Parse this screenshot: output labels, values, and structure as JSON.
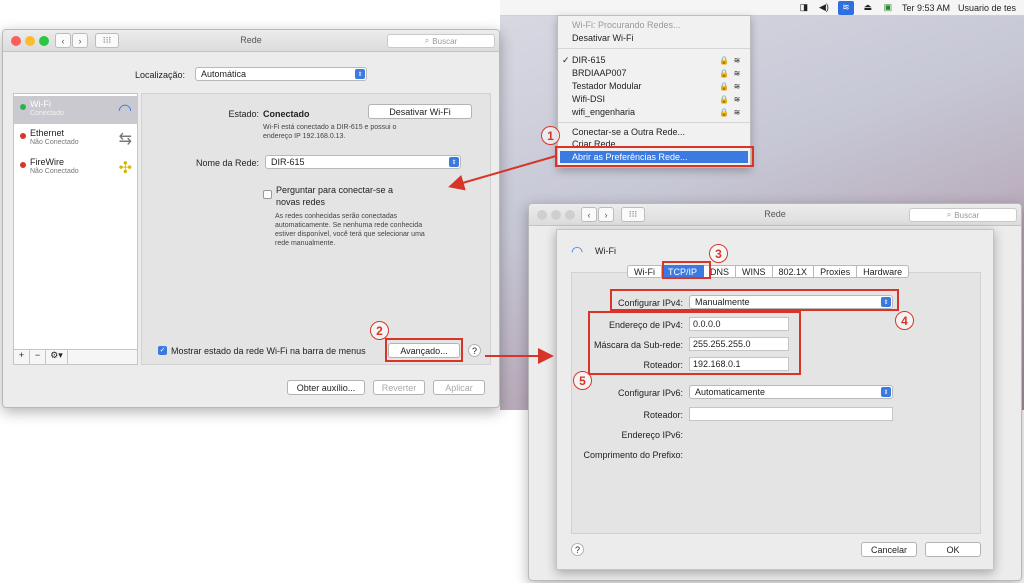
{
  "menubar": {
    "clock": "Ter 9:53 AM",
    "user": "Usuario de tes"
  },
  "wifi_menu": {
    "status": "Wi-Fi: Procurando Redes...",
    "toggle": "Desativar Wi-Fi",
    "networks": [
      {
        "name": "DIR-615",
        "checked": "✓"
      },
      {
        "name": "BRDIAAP007",
        "checked": ""
      },
      {
        "name": "Testador Modular",
        "checked": ""
      },
      {
        "name": "Wifi-DSI",
        "checked": ""
      },
      {
        "name": "wifi_engenharia",
        "checked": ""
      }
    ],
    "other": "Conectar-se a Outra Rede...",
    "create": "Criar Rede...",
    "prefs": "Abrir as Preferências Rede..."
  },
  "main_window": {
    "title": "Rede",
    "search": "Buscar",
    "location_label": "Localização:",
    "location_value": "Automática",
    "services": [
      {
        "name": "Wi-Fi",
        "status": "Conectado",
        "color": "#29b34a"
      },
      {
        "name": "Ethernet",
        "status": "Não Conectado",
        "color": "#d8352a"
      },
      {
        "name": "FireWire",
        "status": "Não Conectado",
        "color": "#d8352a"
      }
    ],
    "state_label": "Estado:",
    "state_value": "Conectado",
    "disable_wifi": "Desativar Wi-Fi",
    "state_desc_1": "Wi-Fi está conectado a DIR-615 e possui o",
    "state_desc_2": "endereço IP 192.168.0.13.",
    "network_label": "Nome da Rede:",
    "network_value": "DIR-615",
    "ask_label_1": "Perguntar para conectar-se a",
    "ask_label_2": "novas redes",
    "ask_desc_1": "As redes conhecidas serão conectadas",
    "ask_desc_2": "automaticamente. Se nenhuma rede conhecida",
    "ask_desc_3": "estiver disponível, você terá que selecionar uma",
    "ask_desc_4": "rede manualmente.",
    "show_menu": "Mostrar estado da rede Wi-Fi na barra de menus",
    "advanced": "Avançado...",
    "help": "?",
    "assist": "Obter auxílio...",
    "revert": "Reverter",
    "apply": "Aplicar",
    "plus": "+",
    "minus": "−",
    "gear": "⚙▾"
  },
  "adv_window": {
    "title": "Rede",
    "search": "Buscar",
    "wifi_label": "Wi-Fi",
    "tabs": [
      "Wi-Fi",
      "TCP/IP",
      "DNS",
      "WINS",
      "802.1X",
      "Proxies",
      "Hardware"
    ],
    "ipv4_label": "Configurar IPv4:",
    "ipv4_value": "Manualmente",
    "ip_label": "Endereço de IPv4:",
    "ip_value": "0.0.0.0",
    "mask_label": "Máscara da Sub-rede:",
    "mask_value": "255.255.255.0",
    "router_label": "Roteador:",
    "router_value": "192.168.0.1",
    "ipv6_label": "Configurar IPv6:",
    "ipv6_value": "Automaticamente",
    "router6_label": "Roteador:",
    "ipv6_addr_label": "Endereço IPv6:",
    "prefix_label": "Comprimento do Prefixo:",
    "cancel": "Cancelar",
    "ok": "OK",
    "help": "?"
  },
  "annotations": [
    "1",
    "2",
    "3",
    "4",
    "5"
  ],
  "colors": {
    "accent": "#3b7ae0",
    "annotation": "#d8352a"
  }
}
